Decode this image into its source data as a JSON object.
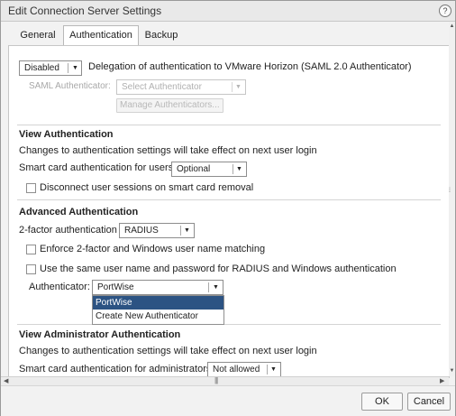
{
  "window": {
    "title": "Edit Connection Server Settings",
    "help_icon": "?"
  },
  "tabs": [
    {
      "label": "General",
      "active": false
    },
    {
      "label": "Authentication",
      "active": true
    },
    {
      "label": "Backup",
      "active": false
    }
  ],
  "delegation": {
    "dropdown_value": "Disabled",
    "label": "Delegation of authentication to VMware Horizon (SAML 2.0 Authenticator)",
    "saml_label": "SAML Authenticator:",
    "saml_placeholder": "Select Authenticator",
    "manage_button": "Manage Authenticators..."
  },
  "view_auth": {
    "heading": "View Authentication",
    "note": "Changes to authentication settings will take effect on next user login",
    "smartcard_label": "Smart card authentication for users:",
    "smartcard_value": "Optional",
    "disconnect_label": "Disconnect user sessions on smart card removal"
  },
  "advanced_auth": {
    "heading": "Advanced Authentication",
    "twofactor_label": "2-factor authentication",
    "twofactor_value": "RADIUS",
    "enforce_label": "Enforce 2-factor and Windows user name matching",
    "same_creds_label": "Use the same user name and password for RADIUS and Windows authentication",
    "authenticator_label": "Authenticator:",
    "authenticator_value": "PortWise",
    "authenticator_options": [
      "PortWise",
      "Create New Authenticator"
    ]
  },
  "admin_auth": {
    "heading": "View Administrator Authentication",
    "note": "Changes to authentication settings will take effect on next user login",
    "smartcard_label": "Smart card authentication for administrators:",
    "smartcard_value": "Not allowed"
  },
  "footer": {
    "ok_label": "OK",
    "cancel_label": "Cancel"
  },
  "colors": {
    "selection": "#2c5383",
    "dialog_bg": "#f2f2f2"
  }
}
